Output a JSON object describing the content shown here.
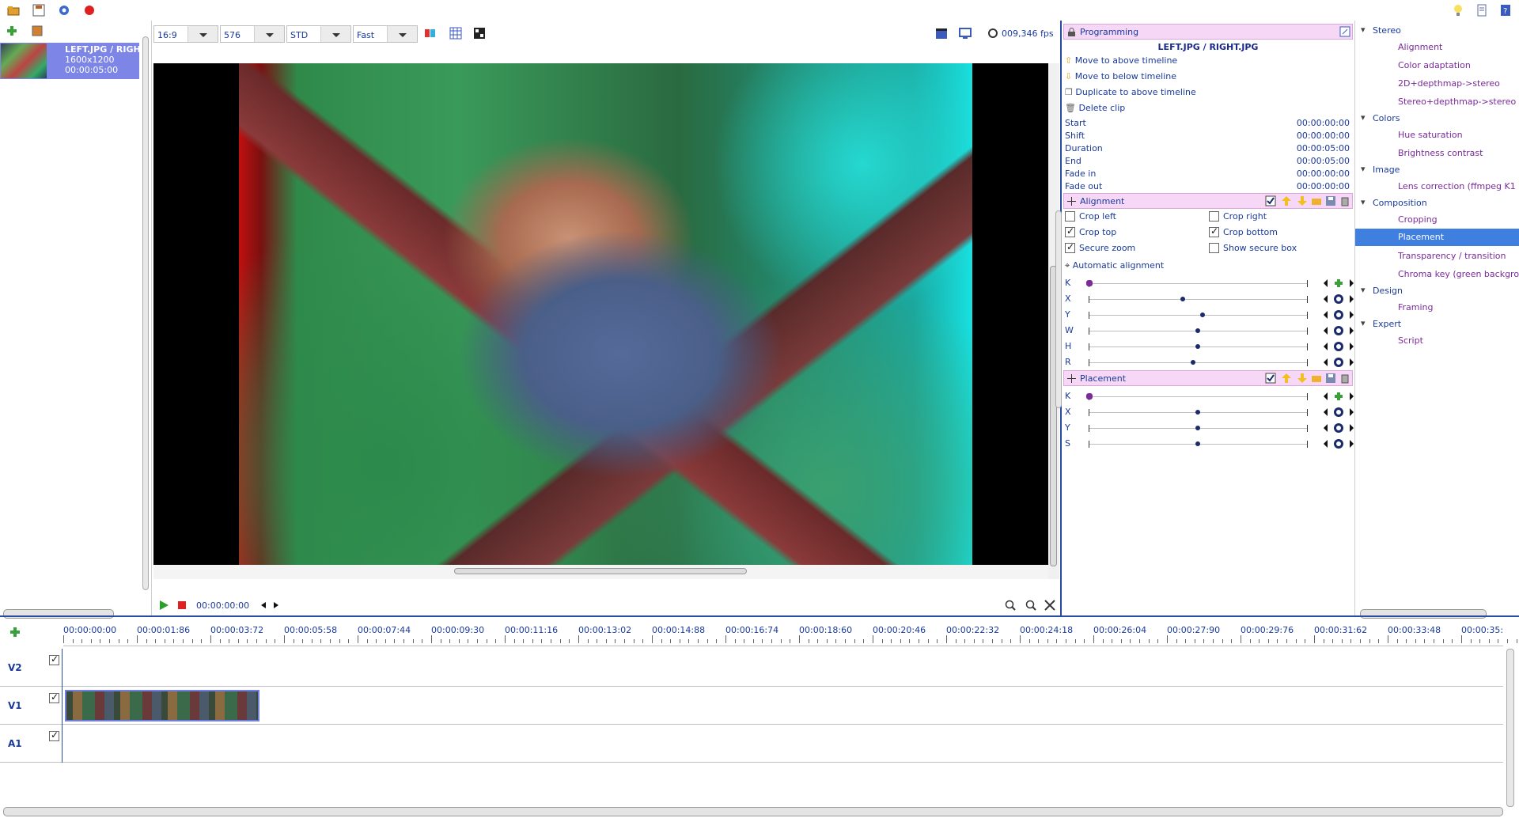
{
  "toolbar": {
    "icons": [
      "open-icon",
      "save-icon",
      "settings-icon",
      "record-icon"
    ],
    "right_icons": [
      "tip-icon",
      "doc-icon",
      "help-icon"
    ]
  },
  "media": {
    "item": {
      "name": "LEFT.JPG / RIGH",
      "size": "1600x1200",
      "duration": "00:00:05:00"
    }
  },
  "viewer": {
    "aspect": "16:9",
    "height": "576",
    "mode": "STD",
    "speed": "Fast",
    "fps": "009,346 fps",
    "time": "00:00:00:00"
  },
  "programming": {
    "title": "Programming",
    "clip_name": "LEFT.JPG / RIGHT.JPG",
    "actions": [
      "Move to above timeline",
      "Move to below timeline",
      "Duplicate to above timeline",
      "Delete clip"
    ],
    "props": [
      {
        "label": "Start",
        "value": "00:00:00:00"
      },
      {
        "label": "Shift",
        "value": "00:00:00:00"
      },
      {
        "label": "Duration",
        "value": "00:00:05:00"
      },
      {
        "label": "End",
        "value": "00:00:05:00"
      },
      {
        "label": "Fade in",
        "value": "00:00:00:00"
      },
      {
        "label": "Fade out",
        "value": "00:00:00:00"
      }
    ],
    "alignment": {
      "title": "Alignment",
      "crop_left": "Crop left",
      "crop_right": "Crop right",
      "crop_top": "Crop top",
      "crop_bottom": "Crop bottom",
      "secure_zoom": "Secure zoom",
      "show_secure_box": "Show secure box",
      "auto": "Automatic alignment",
      "sliders": [
        {
          "label": "K",
          "value": 0.0
        },
        {
          "label": "X",
          "value": 0.43
        },
        {
          "label": "Y",
          "value": 0.52
        },
        {
          "label": "W",
          "value": 0.5
        },
        {
          "label": "H",
          "value": 0.5
        },
        {
          "label": "R",
          "value": 0.48
        }
      ]
    },
    "placement": {
      "title": "Placement",
      "sliders": [
        {
          "label": "K",
          "value": 0.0
        },
        {
          "label": "X",
          "value": 0.5
        },
        {
          "label": "Y",
          "value": 0.5
        },
        {
          "label": "S",
          "value": 0.5
        }
      ]
    }
  },
  "tree": {
    "cats": [
      "Stereo",
      "Colors",
      "Image",
      "Composition",
      "Design",
      "Expert"
    ],
    "items": {
      "stereo": [
        "Alignment",
        "Color adaptation",
        "2D+depthmap->stereo",
        "Stereo+depthmap->stereo"
      ],
      "colors": [
        "Hue saturation",
        "Brightness contrast"
      ],
      "image": [
        "Lens correction (ffmpeg K1"
      ],
      "composition": [
        "Cropping",
        "Placement",
        "Transparency / transition",
        "Chroma key (green backgro"
      ],
      "design": [
        "Framing"
      ],
      "expert": [
        "Script"
      ]
    }
  },
  "timeline": {
    "ruler": [
      "00:00:00:00",
      "00:00:01:86",
      "00:00:03:72",
      "00:00:05:58",
      "00:00:07:44",
      "00:00:09:30",
      "00:00:11:16",
      "00:00:13:02",
      "00:00:14:88",
      "00:00:16:74",
      "00:00:18:60",
      "00:00:20:46",
      "00:00:22:32",
      "00:00:24:18",
      "00:00:26:04",
      "00:00:27:90",
      "00:00:29:76",
      "00:00:31:62",
      "00:00:33:48",
      "00:00:35:"
    ],
    "tracks": [
      "V2",
      "V1",
      "A1"
    ]
  }
}
